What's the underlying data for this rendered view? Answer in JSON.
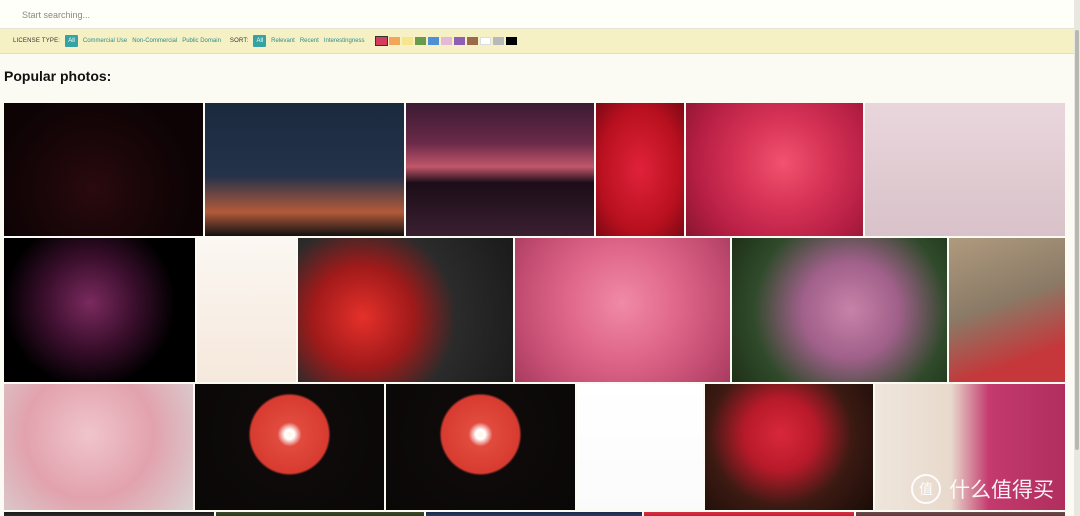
{
  "search": {
    "placeholder": "Start searching..."
  },
  "filters": {
    "license_label": "LICENSE TYPE:",
    "license_options": [
      {
        "label": "All",
        "active": true
      },
      {
        "label": "Commercial Use",
        "active": false
      },
      {
        "label": "Non-Commercial",
        "active": false
      },
      {
        "label": "Public Domain",
        "active": false
      }
    ],
    "sort_label": "SORT:",
    "sort_options": [
      {
        "label": "All",
        "active": true
      },
      {
        "label": "Relevant",
        "active": false
      },
      {
        "label": "Recent",
        "active": false
      },
      {
        "label": "Interestingness",
        "active": false
      }
    ],
    "color_swatches": [
      {
        "color": "#d23d5b",
        "selected": true
      },
      {
        "color": "#f2a65a",
        "selected": false
      },
      {
        "color": "#f6e58d",
        "selected": false
      },
      {
        "color": "#6a9a4e",
        "selected": false
      },
      {
        "color": "#4e8fd6",
        "selected": false
      },
      {
        "color": "#e6b8d8",
        "selected": false
      },
      {
        "color": "#8e5fb5",
        "selected": false
      },
      {
        "color": "#9a6a4a",
        "selected": false
      },
      {
        "color": "#ffffff",
        "selected": false
      },
      {
        "color": "#b9b9b9",
        "selected": false
      },
      {
        "color": "#000000",
        "selected": false
      }
    ]
  },
  "main": {
    "title": "Popular photos:"
  },
  "photos": [
    {
      "name": "photo-speedometer",
      "bg": "radial-gradient(circle at 45% 65%, #2a0a0e 0%, #1a0608 35%, #0d0305 70%), #100406",
      "accent": "#e2263a"
    },
    {
      "name": "photo-night-sky-trees",
      "bg": "linear-gradient(180deg, #1a2a3e 0%, #24324a 55%, #b35a3a 82%, #111 100%)",
      "accent": "#000"
    },
    {
      "name": "photo-city-skyline-dusk",
      "bg": "linear-gradient(180deg, #3b1a33 0%, #6a2a48 30%, #c0566a 48%, #1c0d18 60%, #3a1f30 100%)",
      "accent": "#000"
    },
    {
      "name": "photo-red-petals",
      "bg": "radial-gradient(ellipse at 50% 50%, #e0223a 0%, #b8101f 65%, #7c0814 100%)",
      "accent": "#c0102a"
    },
    {
      "name": "photo-pink-rose",
      "bg": "radial-gradient(circle at 55% 45%, #f2536e 0%, #d83457 35%, #b81f45 70%, #8a1530 100%)",
      "accent": "#f08aa0"
    },
    {
      "name": "photo-pink-dice",
      "bg": "linear-gradient(180deg, #e9d6dc 0%, #d9c2c9 100%)",
      "accent": "#e8306a"
    },
    {
      "name": "photo-purple-daisy",
      "bg": "radial-gradient(circle at 45% 45%, #7a2a5e 0%, #3a0e2c 35%, #000 65%)",
      "accent": "#c6608f"
    },
    {
      "name": "photo-anatomy-body",
      "bg": "linear-gradient(180deg, #fbf7f2 0%, #f6e8dc 100%)",
      "accent": "#e8b79a"
    },
    {
      "name": "photo-red-flower-butterfly",
      "bg": "radial-gradient(circle at 30% 55%, #e5302a 0%, #a01a1a 30%, #2b2b2b 55%, #1a1a1a 100%)",
      "accent": "#ff4a3a"
    },
    {
      "name": "photo-pink-rose-soft",
      "bg": "radial-gradient(circle at 50% 45%, #f08aa6 0%, #e0688a 40%, #c44d73 75%, #a83b5f 100%)",
      "accent": "#f7b6c8"
    },
    {
      "name": "photo-lilac-rose",
      "bg": "radial-gradient(circle at 55% 50%, #c882a8 0%, #a0608a 35%, #2f4a2a 70%, #1e3018 100%)",
      "accent": "#d89ab8"
    },
    {
      "name": "photo-turkey-head",
      "bg": "linear-gradient(160deg, #b09a7e 0%, #8a7a66 45%, #c5373a 80%)",
      "accent": "#d43a3e"
    },
    {
      "name": "photo-pink-umbrella",
      "bg": "radial-gradient(circle at 45% 40%, #f0c4cc 0%, #e2a2ad 50%, #d8d2d2 100%)",
      "accent": "#c46a7a"
    },
    {
      "name": "photo-red-lamp-1",
      "bg": "radial-gradient(circle at 50% 40%, #fff8e0 0%, #fff 4%, #e14b3e 10%, #d83b30 32%, #0e0a0a 34%, #0a0707 100%)",
      "accent": "#d83b30"
    },
    {
      "name": "photo-red-lamp-2",
      "bg": "radial-gradient(circle at 50% 40%, #fff8e0 0%, #fff 4%, #e14b3e 10%, #d83b30 32%, #0e0a0a 34%, #0a0707 100%)",
      "accent": "#d83b30"
    },
    {
      "name": "photo-red-heels",
      "bg": "linear-gradient(180deg, #ffffff 0%, #fbfbfb 100%)",
      "accent": "#d8232a"
    },
    {
      "name": "photo-red-roses-bunch",
      "bg": "radial-gradient(circle at 45% 40%, #d8283a 0%, #b81a2a 30%, #3b1a12 60%, #1a0c08 100%)",
      "accent": "#e8323e"
    },
    {
      "name": "photo-pink-teddy",
      "bg": "linear-gradient(90deg, #efe6dc 0%, #e8d9cc 40%, #c43a6e 60%, #b02e5e 100%)",
      "accent": "#c43a6e"
    },
    {
      "name": "photo-bottom-1",
      "bg": "linear-gradient(180deg, #1a1a1a 0%, #2a2a2a 100%)",
      "accent": "#000"
    },
    {
      "name": "photo-bottom-2",
      "bg": "linear-gradient(180deg, #3a4a2a 0%, #2a3a1a 100%)",
      "accent": "#000"
    },
    {
      "name": "photo-bottom-3",
      "bg": "linear-gradient(180deg, #1a2a4a 0%, #2a3a5a 100%)",
      "accent": "#000"
    },
    {
      "name": "photo-bottom-4",
      "bg": "linear-gradient(180deg, #d83040 0%, #c02030 100%)",
      "accent": "#000"
    },
    {
      "name": "photo-bottom-5",
      "bg": "linear-gradient(180deg, #6a4a4a 0%, #5a3a3a 100%)",
      "accent": "#000"
    }
  ],
  "watermark": {
    "logo": "值",
    "text": "什么值得买"
  }
}
